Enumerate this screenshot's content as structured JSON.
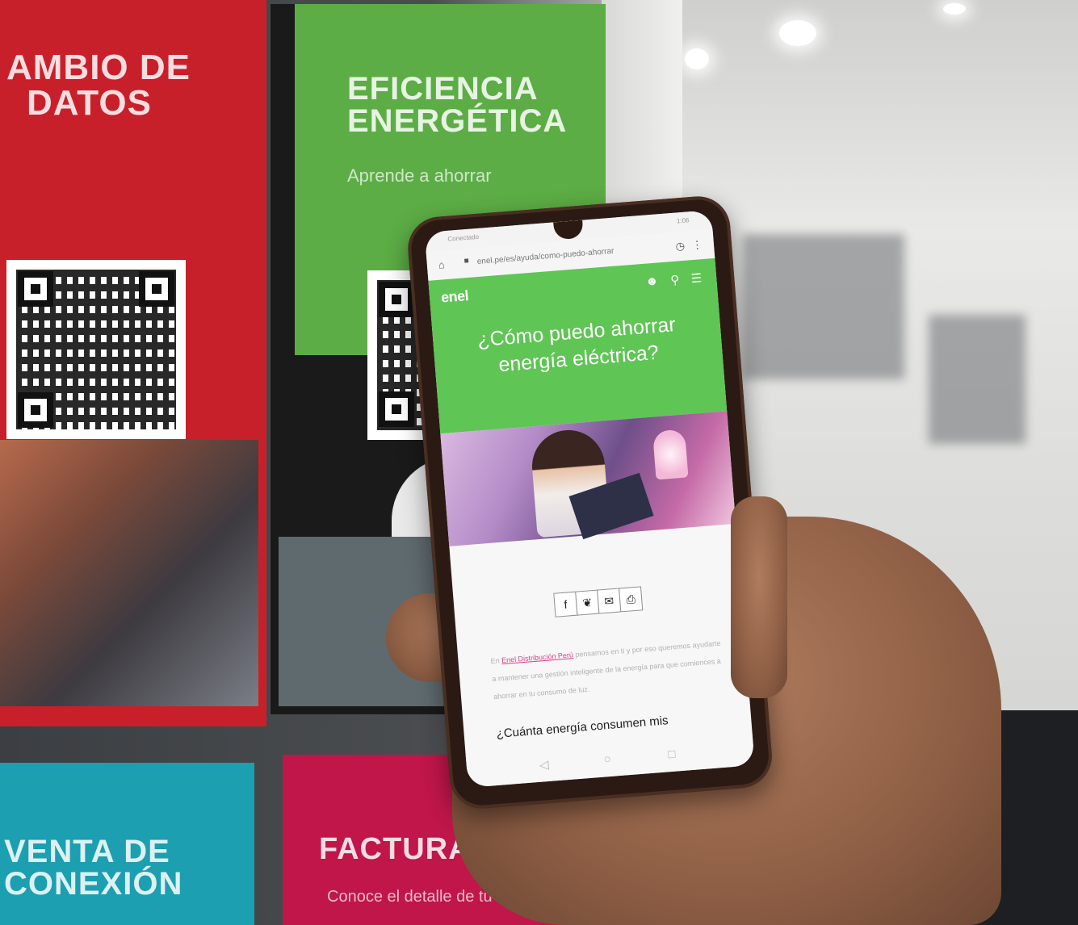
{
  "posters": {
    "cambio": {
      "title_line1": "AMBIO DE",
      "title_line2": "DATOS",
      "color": "#c8202b"
    },
    "eficiencia": {
      "title_line1": "EFICIENCIA",
      "title_line2": "ENERGÉTICA",
      "subtitle": "Aprende a ahorrar",
      "color": "#5cad45"
    },
    "venta": {
      "title_line1": "VENTA DE",
      "title_line2": "CONEXIÓN",
      "color": "#1c9fb0"
    },
    "factura": {
      "title_line1": "FACTURA",
      "subtitle": "Conoce el detalle de tu",
      "color": "#c0164a"
    }
  },
  "phone": {
    "status": {
      "left": "Conectado",
      "right": "1:06"
    },
    "browser": {
      "url": "enel.pe/es/ayuda/como-puedo-ahorrar"
    },
    "site": {
      "logo": "enel",
      "headline_line1": "¿Cómo puedo ahorrar",
      "headline_line2": "energía eléctrica?",
      "intro_prefix": "En ",
      "intro_link": "Enel Distribución Perú",
      "intro_rest": " pensamos en ti y por eso queremos ayudarte a mantener una gestión inteligente de la energía para que comiences a ahorrar en tu consumo de luz.",
      "subhead": "¿Cuánta energía consumen mis"
    },
    "share_icons": [
      "facebook-icon",
      "twitter-icon",
      "mail-icon",
      "print-icon"
    ],
    "colors": {
      "enel_green": "#5fc555",
      "link_pink": "#d8408a"
    }
  }
}
